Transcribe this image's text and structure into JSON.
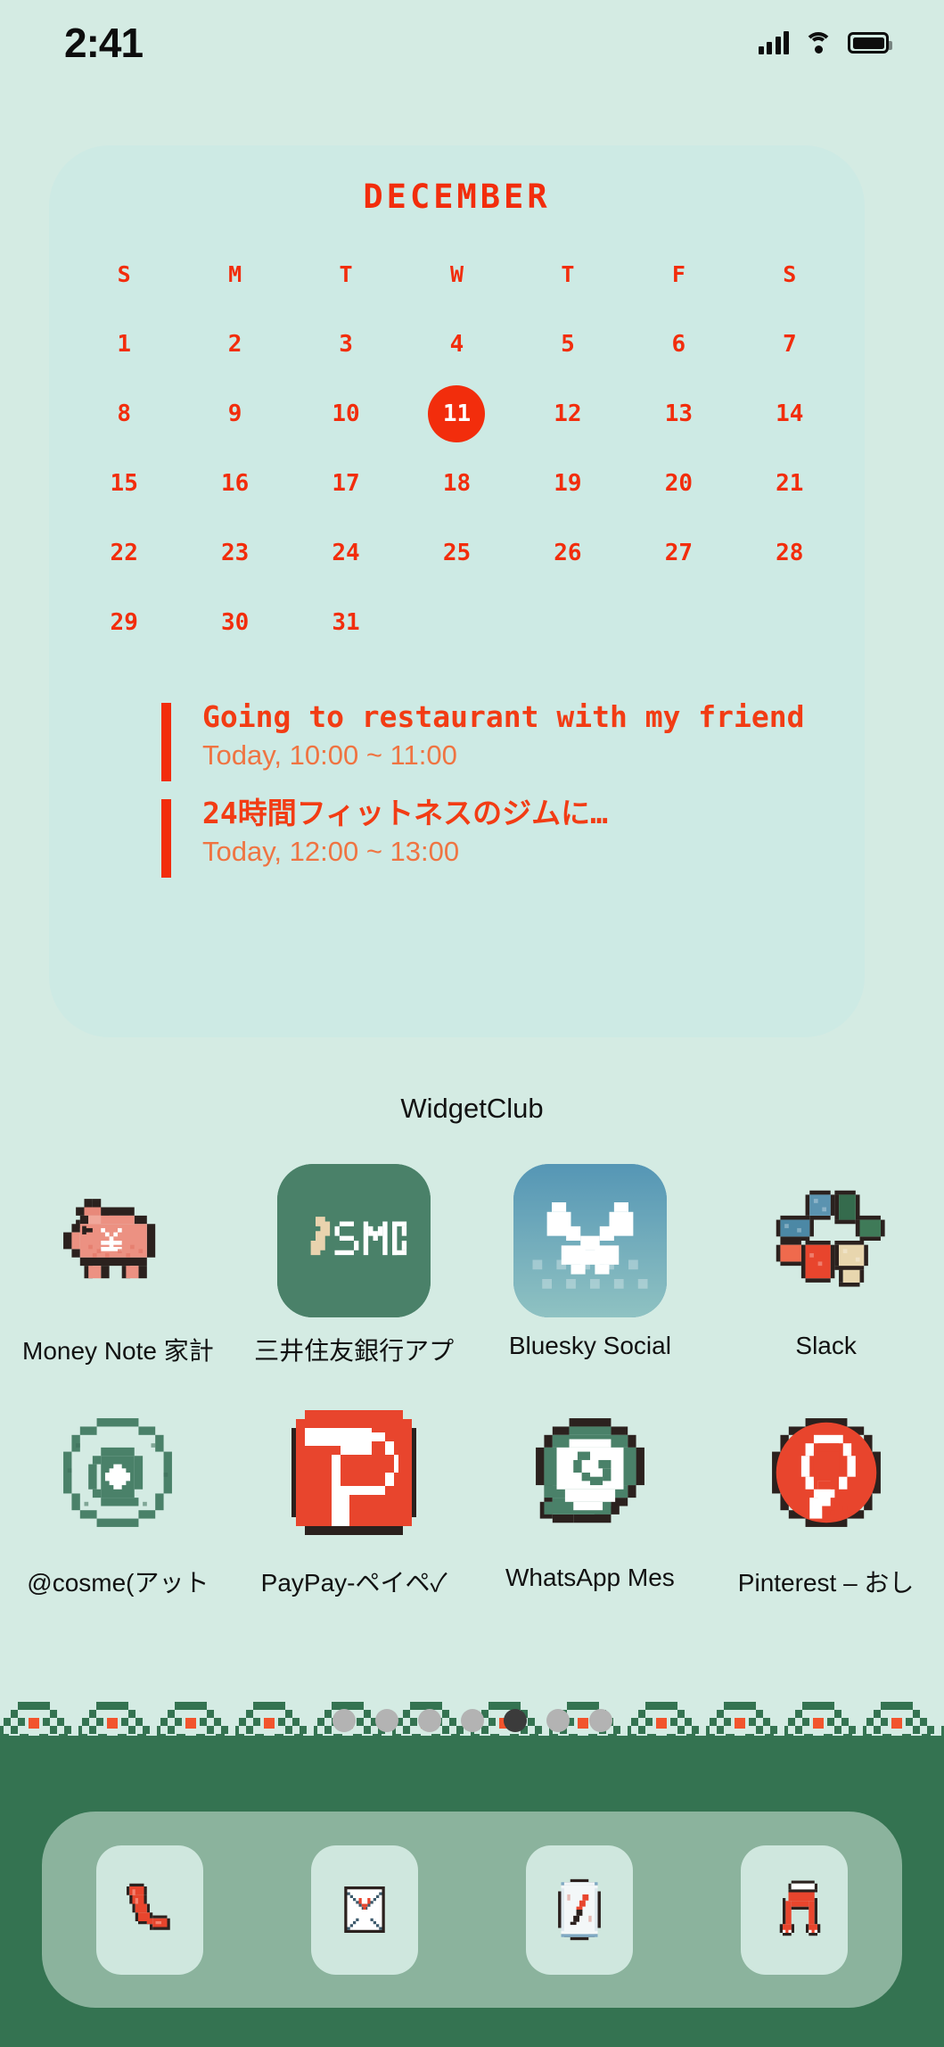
{
  "status_bar": {
    "time": "2:41",
    "signal_icon": "cellular-signal-icon",
    "wifi_icon": "wifi-icon",
    "battery_icon": "battery-full-icon"
  },
  "widget": {
    "name": "WidgetClub",
    "label": "WidgetClub",
    "month": "DECEMBER",
    "accent_color": "#f22d0c",
    "card_color": "#cdeae4",
    "day_headers": [
      "S",
      "M",
      "T",
      "W",
      "T",
      "F",
      "S"
    ],
    "leading_blanks": 0,
    "days": [
      1,
      2,
      3,
      4,
      5,
      6,
      7,
      8,
      9,
      10,
      11,
      12,
      13,
      14,
      15,
      16,
      17,
      18,
      19,
      20,
      21,
      22,
      23,
      24,
      25,
      26,
      27,
      28,
      29,
      30,
      31
    ],
    "today": 11,
    "events": [
      {
        "title": "Going to restaurant with my friend",
        "time": "Today, 10:00 ~ 11:00"
      },
      {
        "title": "24時間フィットネスのジムに…",
        "time": "Today, 12:00 ~ 13:00"
      }
    ]
  },
  "apps": [
    {
      "label": "Money Note 家計",
      "icon": "piggy-bank-icon",
      "style": "transparent"
    },
    {
      "label": "三井住友銀行アプ",
      "icon": "smbc-icon",
      "style": "tile",
      "bg": "#4a8169"
    },
    {
      "label": "Bluesky Social",
      "icon": "bluesky-butterfly-icon",
      "style": "tile",
      "bg": "#5596b5"
    },
    {
      "label": "Slack",
      "icon": "slack-icon",
      "style": "transparent"
    },
    {
      "label": "@cosme(アット",
      "icon": "cosme-icon",
      "style": "transparent"
    },
    {
      "label": "PayPay-ペイペ✓",
      "icon": "paypay-icon",
      "style": "transparent"
    },
    {
      "label": "WhatsApp Mes",
      "icon": "whatsapp-icon",
      "style": "transparent"
    },
    {
      "label": "Pinterest – おし",
      "icon": "pinterest-icon",
      "style": "transparent"
    }
  ],
  "page_dots": {
    "count": 7,
    "active_index": 4
  },
  "dock": {
    "background_color": "#347351",
    "tray_color": "#8bb39d",
    "items": [
      {
        "icon": "phone-icon"
      },
      {
        "icon": "mail-icon"
      },
      {
        "icon": "safari-compass-icon"
      },
      {
        "icon": "music-note-icon"
      }
    ]
  },
  "theme": {
    "wallpaper_color": "#d4ebe3",
    "border_green": "#347351",
    "border_orange": "#f2542d"
  }
}
